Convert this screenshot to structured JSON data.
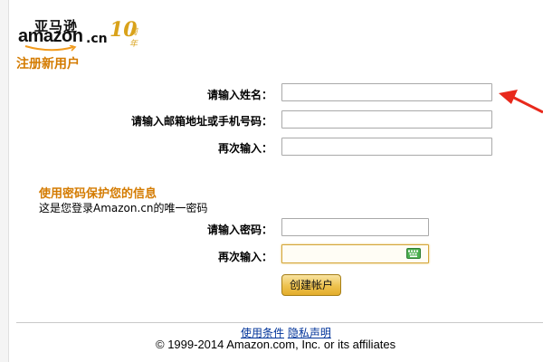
{
  "logo": {
    "brand_cn": "亚马逊",
    "brand_word": "amazon",
    "brand_suffix": ".cn",
    "anniversary_number": "10",
    "anniversary_text": "周年"
  },
  "page_title": "注册新用户",
  "registration": {
    "name_label": "请输入姓名：",
    "name_value": "",
    "email_label": "请输入邮箱地址或手机号码：",
    "email_value": "",
    "email_confirm_label": "再次输入：",
    "email_confirm_value": ""
  },
  "password_section": {
    "title": "使用密码保护您的信息",
    "description": "这是您登录Amazon.cn的唯一密码",
    "password_label": "请输入密码：",
    "password_value": "",
    "password_confirm_label": "再次输入：",
    "password_confirm_value": ""
  },
  "create_button_label": "创建帐户",
  "footer": {
    "terms_link": "使用条件",
    "privacy_link": "隐私声明",
    "copyright": "© 1999-2014 Amazon.com, Inc. or its affiliates"
  },
  "colors": {
    "accent": "#d47b00",
    "button": "#eec24e",
    "focus_border": "#d4a63a",
    "arrow": "#e8291c",
    "keyboard_icon": "#4caf50"
  }
}
